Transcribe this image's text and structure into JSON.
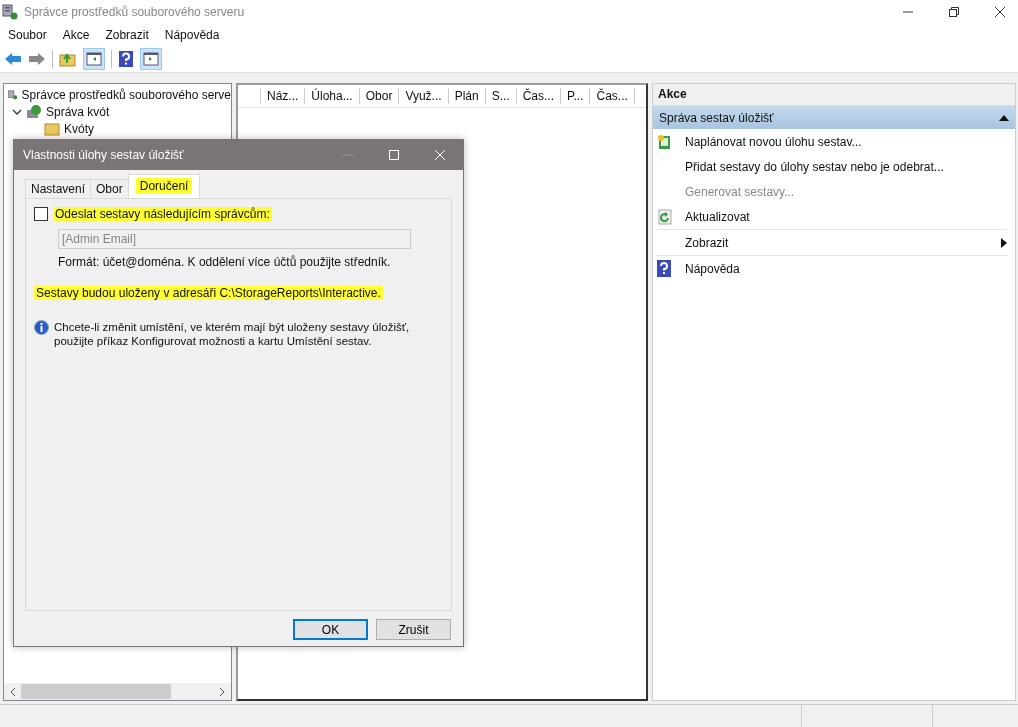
{
  "window": {
    "title": "Správce prostředků souborového serveru"
  },
  "menu": [
    "Soubor",
    "Akce",
    "Zobrazit",
    "Nápověda"
  ],
  "tree": [
    {
      "label": "Správce prostředků souborového serve",
      "children": [
        {
          "label": "Správa kvót",
          "expanded": true,
          "children": [
            {
              "label": "Kvóty"
            }
          ]
        }
      ]
    }
  ],
  "table": {
    "columns": [
      "Náz...",
      "Úloha...",
      "Obor",
      "Využ...",
      "Plán",
      "S...",
      "Čas...",
      "P...",
      "Čas..."
    ]
  },
  "actions": {
    "title": "Akce",
    "section": "Správa sestav úložišť",
    "expanded": true,
    "items": [
      {
        "label": "Naplánovat novou úlohu sestav...",
        "kind": "schedule",
        "disabled": false,
        "submenu": false
      },
      {
        "label": "Přidat sestavy do úlohy sestav nebo je odebrat...",
        "kind": "plain",
        "disabled": false,
        "submenu": false
      },
      {
        "label": "Generovat sestavy...",
        "kind": "plain",
        "disabled": true,
        "submenu": false
      },
      {
        "label": "Aktualizovat",
        "kind": "refresh",
        "disabled": false,
        "submenu": false
      },
      {
        "label": "Zobrazit",
        "kind": "plain",
        "disabled": false,
        "submenu": true
      },
      {
        "label": "Nápověda",
        "kind": "help",
        "disabled": false,
        "submenu": false
      }
    ]
  },
  "dialog": {
    "title": "Vlastnosti úlohy sestav úložišť",
    "tabs": [
      {
        "label": "Nastavení",
        "selected": false,
        "highlighted": false
      },
      {
        "label": "Obor",
        "selected": false,
        "highlighted": false
      },
      {
        "label": "Doručení",
        "selected": true,
        "highlighted": true
      }
    ],
    "send_checkbox": {
      "label": "Odeslat sestavy následujícím správcům:",
      "checked": false,
      "highlighted": true
    },
    "email": {
      "placeholder": "[Admin Email]",
      "disabled": true
    },
    "format_hint": "Formát: účet@doména. K oddělení více účtů použijte středník.",
    "location": {
      "text": "Sestavy budou uloženy v adresáři C:\\StorageReports\\Interactive.",
      "highlighted": true
    },
    "info": "Chcete-li změnit umístění, ve kterém mají být uloženy sestavy úložišť, použijte příkaz Konfigurovat možnosti a kartu Umístění sestav.",
    "buttons": [
      {
        "label": "OK",
        "default": true
      },
      {
        "label": "Zrušit",
        "default": false
      }
    ]
  }
}
